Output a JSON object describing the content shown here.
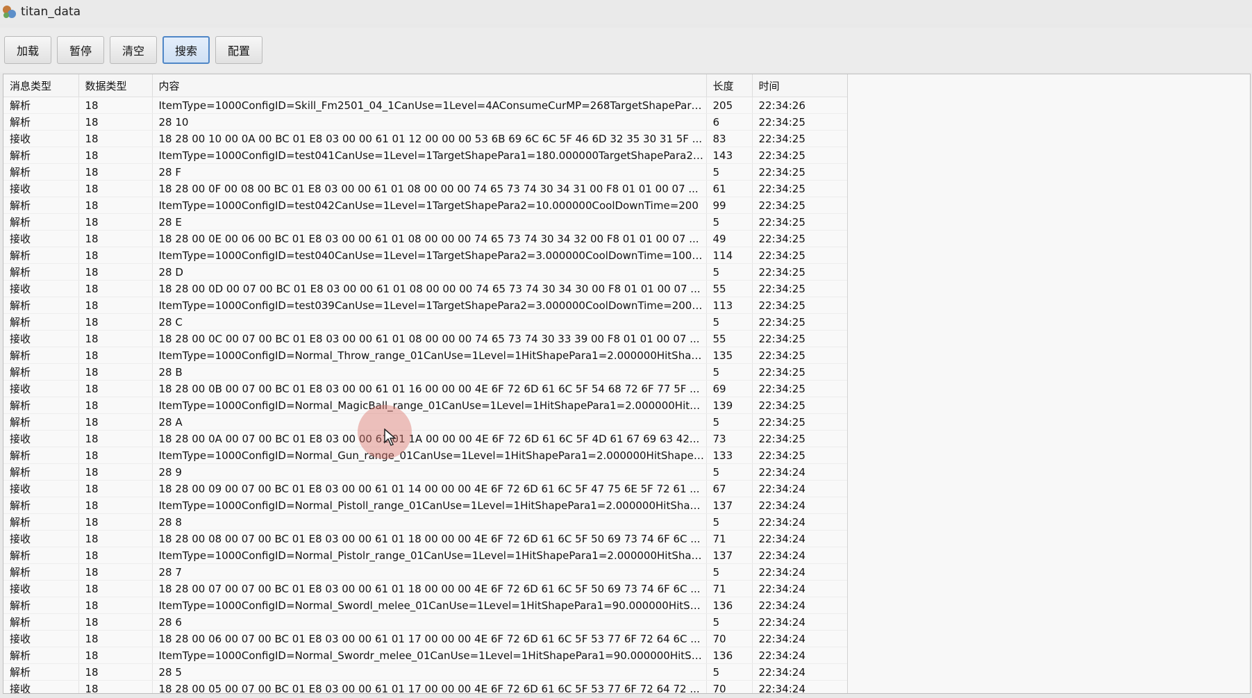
{
  "window": {
    "title": "titan_data"
  },
  "toolbar": {
    "buttons": [
      "加载",
      "暂停",
      "清空",
      "搜索",
      "配置"
    ],
    "active_index": 3
  },
  "table": {
    "columns": [
      "消息类型",
      "数据类型",
      "内容",
      "长度",
      "时间"
    ],
    "rows": [
      [
        "解析",
        "18",
        "ItemType=1000ConfigID=Skill_Fm2501_04_1CanUse=1Level=4AConsumeCurMP=268TargetShapePara1...",
        "205",
        "22:34:26"
      ],
      [
        "解析",
        "18",
        "28 10",
        "6",
        "22:34:25"
      ],
      [
        "接收",
        "18",
        "18 28 00 10 00 0A 00 BC 01 E8 03 00 00 61 01 12 00 00 00 53 6B 69 6C 6C 5F 46 6D 32 35 30 31 5F ...",
        "83",
        "22:34:25"
      ],
      [
        "解析",
        "18",
        "ItemType=1000ConfigID=test041CanUse=1Level=1TargetShapePara1=180.000000TargetShapePara2=...",
        "143",
        "22:34:25"
      ],
      [
        "解析",
        "18",
        "28 F",
        "5",
        "22:34:25"
      ],
      [
        "接收",
        "18",
        "18 28 00 0F 00 08 00 BC 01 E8 03 00 00 61 01 08 00 00 00 74 65 73 74 30 34 31 00 F8 01 01 00 07 ...",
        "61",
        "22:34:25"
      ],
      [
        "解析",
        "18",
        "ItemType=1000ConfigID=test042CanUse=1Level=1TargetShapePara2=10.000000CoolDownTime=200",
        "99",
        "22:34:25"
      ],
      [
        "解析",
        "18",
        "28 E",
        "5",
        "22:34:25"
      ],
      [
        "接收",
        "18",
        "18 28 00 0E 00 06 00 BC 01 E8 03 00 00 61 01 08 00 00 00 74 65 73 74 30 34 32 00 F8 01 01 00 07 ...",
        "49",
        "22:34:25"
      ],
      [
        "解析",
        "18",
        "ItemType=1000ConfigID=test040CanUse=1Level=1TargetShapePara2=3.000000CoolDownTime=1000...",
        "114",
        "22:34:25"
      ],
      [
        "解析",
        "18",
        "28 D",
        "5",
        "22:34:25"
      ],
      [
        "接收",
        "18",
        "18 28 00 0D 00 07 00 BC 01 E8 03 00 00 61 01 08 00 00 00 74 65 73 74 30 34 30 00 F8 01 01 00 07 ...",
        "55",
        "22:34:25"
      ],
      [
        "解析",
        "18",
        "ItemType=1000ConfigID=test039CanUse=1Level=1TargetShapePara2=3.000000CoolDownTime=200L...",
        "113",
        "22:34:25"
      ],
      [
        "解析",
        "18",
        "28 C",
        "5",
        "22:34:25"
      ],
      [
        "接收",
        "18",
        "18 28 00 0C 00 07 00 BC 01 E8 03 00 00 61 01 08 00 00 00 74 65 73 74 30 33 39 00 F8 01 01 00 07 ...",
        "55",
        "22:34:25"
      ],
      [
        "解析",
        "18",
        "ItemType=1000ConfigID=Normal_Throw_range_01CanUse=1Level=1HitShapePara1=2.000000HitShape...",
        "135",
        "22:34:25"
      ],
      [
        "解析",
        "18",
        "28 B",
        "5",
        "22:34:25"
      ],
      [
        "接收",
        "18",
        "18 28 00 0B 00 07 00 BC 01 E8 03 00 00 61 01 16 00 00 00 4E 6F 72 6D 61 6C 5F 54 68 72 6F 77 5F ...",
        "69",
        "22:34:25"
      ],
      [
        "解析",
        "18",
        "ItemType=1000ConfigID=Normal_MagicBall_range_01CanUse=1Level=1HitShapePara1=2.000000HitSha...",
        "139",
        "22:34:25"
      ],
      [
        "解析",
        "18",
        "28 A",
        "5",
        "22:34:25"
      ],
      [
        "接收",
        "18",
        "18 28 00 0A 00 07 00 BC 01 E8 03 00 00 61 01 1A 00 00 00 4E 6F 72 6D 61 6C 5F 4D 61 67 69 63 42...",
        "73",
        "22:34:25"
      ],
      [
        "解析",
        "18",
        "ItemType=1000ConfigID=Normal_Gun_range_01CanUse=1Level=1HitShapePara1=2.000000HitShapePa...",
        "133",
        "22:34:25"
      ],
      [
        "解析",
        "18",
        "28 9",
        "5",
        "22:34:24"
      ],
      [
        "接收",
        "18",
        "18 28 00 09 00 07 00 BC 01 E8 03 00 00 61 01 14 00 00 00 4E 6F 72 6D 61 6C 5F 47 75 6E 5F 72 61 ...",
        "67",
        "22:34:24"
      ],
      [
        "解析",
        "18",
        "ItemType=1000ConfigID=Normal_Pistoll_range_01CanUse=1Level=1HitShapePara1=2.000000HitShapeP...",
        "137",
        "22:34:24"
      ],
      [
        "解析",
        "18",
        "28 8",
        "5",
        "22:34:24"
      ],
      [
        "接收",
        "18",
        "18 28 00 08 00 07 00 BC 01 E8 03 00 00 61 01 18 00 00 00 4E 6F 72 6D 61 6C 5F 50 69 73 74 6F 6C ...",
        "71",
        "22:34:24"
      ],
      [
        "解析",
        "18",
        "ItemType=1000ConfigID=Normal_Pistolr_range_01CanUse=1Level=1HitShapePara1=2.000000HitShape...",
        "137",
        "22:34:24"
      ],
      [
        "解析",
        "18",
        "28 7",
        "5",
        "22:34:24"
      ],
      [
        "接收",
        "18",
        "18 28 00 07 00 07 00 BC 01 E8 03 00 00 61 01 18 00 00 00 4E 6F 72 6D 61 6C 5F 50 69 73 74 6F 6C ...",
        "71",
        "22:34:24"
      ],
      [
        "解析",
        "18",
        "ItemType=1000ConfigID=Normal_Swordl_melee_01CanUse=1Level=1HitShapePara1=90.000000HitSha...",
        "136",
        "22:34:24"
      ],
      [
        "解析",
        "18",
        "28 6",
        "5",
        "22:34:24"
      ],
      [
        "接收",
        "18",
        "18 28 00 06 00 07 00 BC 01 E8 03 00 00 61 01 17 00 00 00 4E 6F 72 6D 61 6C 5F 53 77 6F 72 64 6C ...",
        "70",
        "22:34:24"
      ],
      [
        "解析",
        "18",
        "ItemType=1000ConfigID=Normal_Swordr_melee_01CanUse=1Level=1HitShapePara1=90.000000HitSha...",
        "136",
        "22:34:24"
      ],
      [
        "解析",
        "18",
        "28 5",
        "5",
        "22:34:24"
      ],
      [
        "接收",
        "18",
        "18 28 00 05 00 07 00 BC 01 E8 03 00 00 61 01 17 00 00 00 4E 6F 72 6D 61 6C 5F 53 77 6F 72 64 72 ...",
        "70",
        "22:34:24"
      ]
    ]
  }
}
